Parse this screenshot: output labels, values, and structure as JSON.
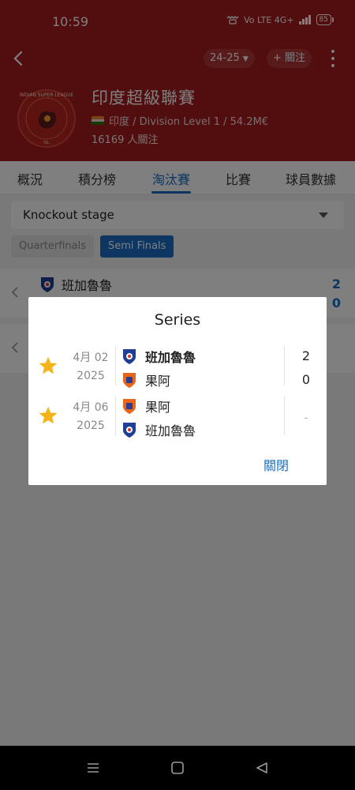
{
  "status_bar": {
    "time": "10:59",
    "indicators": "Vo LTE 4G+",
    "battery": "85"
  },
  "header": {
    "season": "24-25",
    "follow_label": "+ 關注",
    "league_name": "印度超級聯賽",
    "league_meta": "印度 / Division Level 1 / 54.2M€",
    "followers": "16169 人關注"
  },
  "tabs": [
    {
      "label": "概況"
    },
    {
      "label": "積分榜"
    },
    {
      "label": "淘汰賽",
      "active": true
    },
    {
      "label": "比賽"
    },
    {
      "label": "球員數據"
    }
  ],
  "stage_dropdown": {
    "selected": "Knockout stage"
  },
  "round_chips": [
    {
      "label": "Quarterfinals",
      "active": false
    },
    {
      "label": "Semi Finals",
      "active": true
    }
  ],
  "background_cards": [
    {
      "team": "班加魯魯",
      "score_top": "2",
      "score_bottom": "0"
    }
  ],
  "dialog": {
    "title": "Series",
    "matches": [
      {
        "date_line1": "4月 02",
        "date_line2": "2025",
        "home": "班加魯魯",
        "away": "果阿",
        "home_score": "2",
        "away_score": "0"
      },
      {
        "date_line1": "4月 06",
        "date_line2": "2025",
        "home": "果阿",
        "away": "班加魯魯",
        "score": "-"
      }
    ],
    "close_label": "關閉"
  },
  "colors": {
    "brand_red": "#a51a1c",
    "accent_blue": "#1a6fc4",
    "star": "#f5b31b",
    "bengaluru_blue": "#1e3f94",
    "goa_orange": "#e8651a"
  }
}
